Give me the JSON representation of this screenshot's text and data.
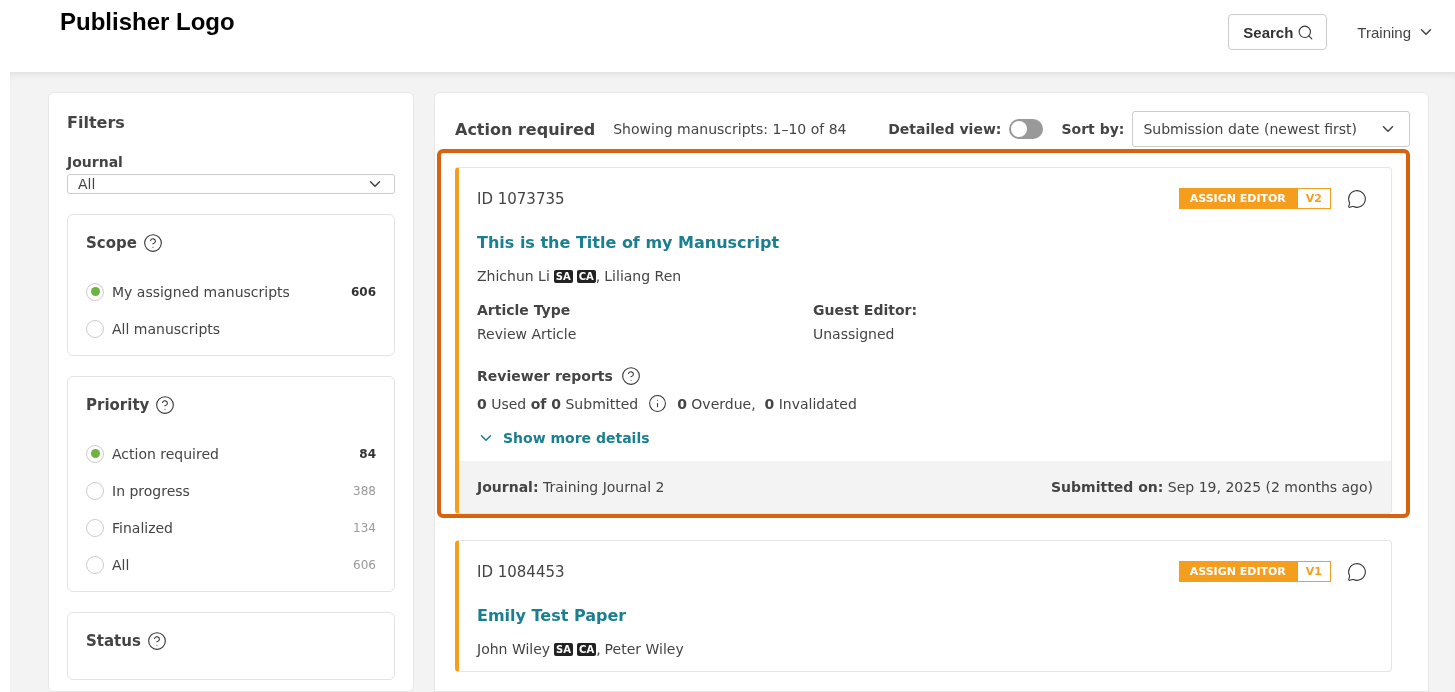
{
  "header": {
    "logo": "Publisher Logo",
    "search_button": "Search",
    "user_menu": "Training"
  },
  "filters": {
    "title": "Filters",
    "journal": {
      "label": "Journal",
      "value": "All"
    },
    "groups": [
      {
        "title": "Scope",
        "options": [
          {
            "label": "My assigned manuscripts",
            "count": "606",
            "selected": true
          },
          {
            "label": "All manuscripts",
            "selected": false
          }
        ]
      },
      {
        "title": "Priority",
        "options": [
          {
            "label": "Action required",
            "count": "84",
            "selected": true
          },
          {
            "label": "In progress",
            "count": "388",
            "selected": false
          },
          {
            "label": "Finalized",
            "count": "134",
            "selected": false
          },
          {
            "label": "All",
            "count": "606",
            "selected": false
          }
        ]
      },
      {
        "title": "Status"
      }
    ]
  },
  "list": {
    "title": "Action required",
    "showing": "Showing manuscripts: 1–10 of 84",
    "detailed_view": {
      "label": "Detailed view:",
      "on": false
    },
    "sort": {
      "label": "Sort by:",
      "value": "Submission date (newest first)"
    },
    "manuscripts": [
      {
        "id": "ID 1073735",
        "highlighted": true,
        "status": "ASSIGN EDITOR",
        "version": "V2",
        "title": "This is the Title of my Manuscript",
        "authors": [
          {
            "name": "Zhichun Li",
            "badges": [
              "SA",
              "CA"
            ],
            "separator": ","
          },
          {
            "name": "Liliang Ren"
          }
        ],
        "article_type_label": "Article Type",
        "article_type": "Review Article",
        "guest_editor_label": "Guest Editor:",
        "guest_editor": "Unassigned",
        "reviewer_reports_label": "Reviewer reports",
        "reports_used": "**0** Used **of 0** Submitted",
        "reports_other": "**0** Overdue,  **0** Invalidated",
        "show_more": "Show more details",
        "journal_label": "Journal:",
        "journal": "Training Journal 2",
        "submitted_label": "Submitted on:",
        "submitted": "Sep 19, 2025 (2 months ago)"
      },
      {
        "id": "ID 1084453",
        "highlighted": false,
        "status": "ASSIGN EDITOR",
        "version": "V1",
        "title": "Emily Test Paper",
        "authors": [
          {
            "name": "John Wiley",
            "badges": [
              "SA",
              "CA"
            ],
            "separator": ","
          },
          {
            "name": "Peter Wiley"
          }
        ]
      }
    ]
  }
}
